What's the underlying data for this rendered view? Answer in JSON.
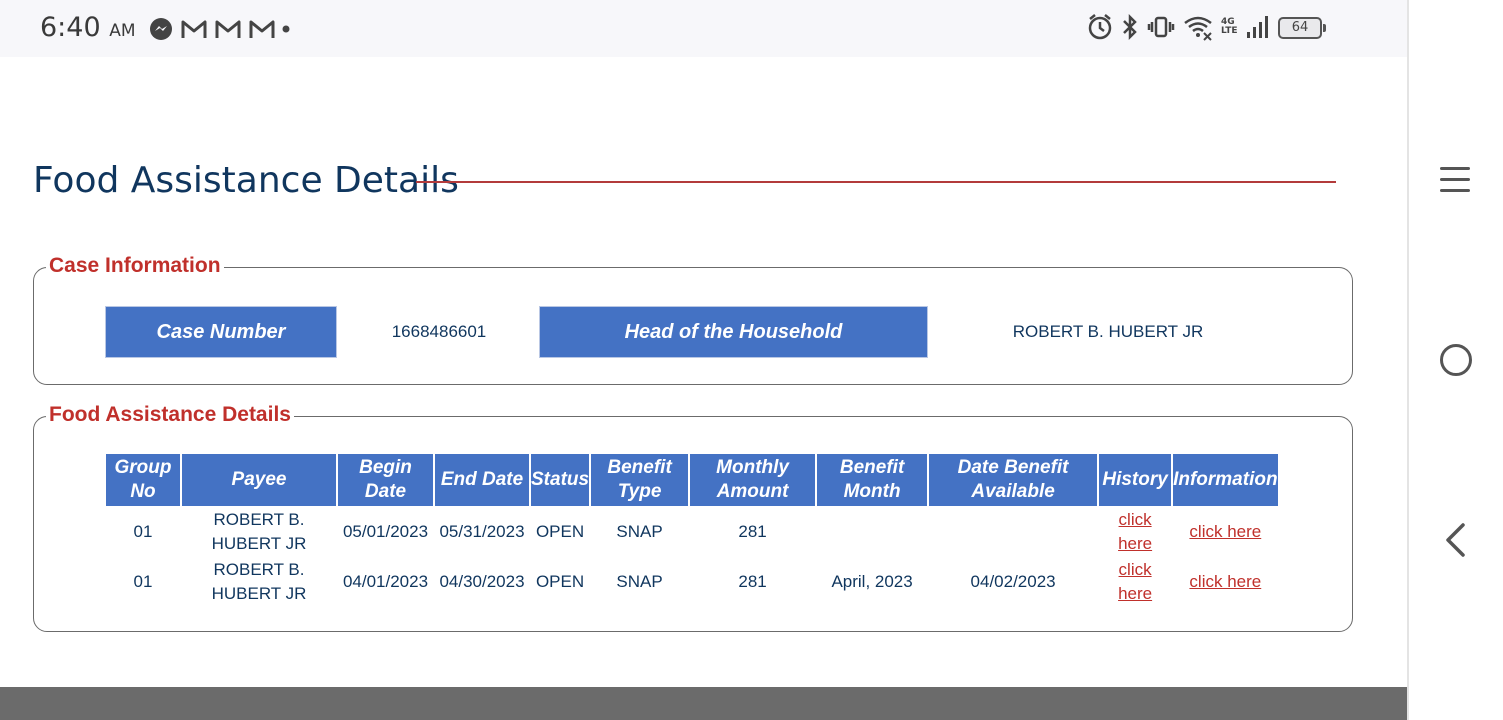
{
  "status_bar": {
    "time": "6:40",
    "ampm": "AM",
    "battery": "64",
    "network_label": "4G LTE",
    "notification_icons": [
      "messenger-icon",
      "gmail-icon",
      "gmail-icon",
      "gmail-icon",
      "dot-icon"
    ],
    "system_icons": [
      "alarm-icon",
      "bluetooth-icon",
      "vibrate-icon",
      "wifi-icon",
      "lte-icon",
      "signal-icon",
      "battery-icon"
    ]
  },
  "page": {
    "title": "Food Assistance Details",
    "accent_color": "#c0302b",
    "header_color": "#4472c4",
    "title_color": "#10365e"
  },
  "case_info": {
    "legend": "Case Information",
    "case_number_label": "Case Number",
    "case_number": "1668486601",
    "head_label": "Head of the Household",
    "head_value": "ROBERT B. HUBERT JR"
  },
  "food_details": {
    "legend": "Food Assistance Details",
    "headers": {
      "group_no": "Group No",
      "payee": "Payee",
      "begin_date": "Begin Date",
      "end_date": "End Date",
      "status": "Status",
      "benefit_type": "Benefit Type",
      "monthly_amount": "Monthly Amount",
      "benefit_month": "Benefit Month",
      "date_available": "Date Benefit Available",
      "history": "History",
      "information": "Information"
    },
    "rows": [
      {
        "group_no": "01",
        "payee": "ROBERT B. HUBERT JR",
        "begin_date": "05/01/2023",
        "end_date": "05/31/2023",
        "status": "OPEN",
        "benefit_type": "SNAP",
        "monthly_amount": "281",
        "benefit_month": "",
        "date_available": "",
        "history": "click here",
        "information": "click here"
      },
      {
        "group_no": "01",
        "payee": "ROBERT B. HUBERT JR",
        "begin_date": "04/01/2023",
        "end_date": "04/30/2023",
        "status": "OPEN",
        "benefit_type": "SNAP",
        "monthly_amount": "281",
        "benefit_month": "April, 2023",
        "date_available": "04/02/2023",
        "history": "click here",
        "information": "click here"
      }
    ]
  },
  "nav": {
    "icons": [
      "menu-icon",
      "home-icon",
      "back-icon"
    ]
  }
}
